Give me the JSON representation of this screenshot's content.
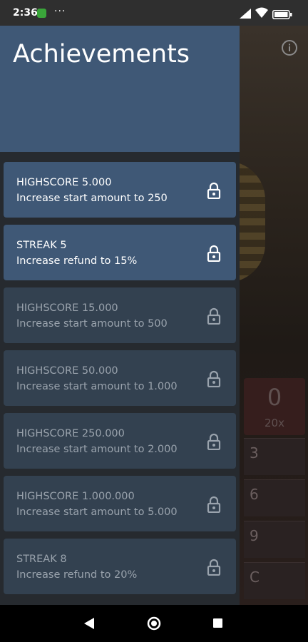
{
  "status_bar": {
    "time": "2:36",
    "more": "···"
  },
  "drawer": {
    "title": "Achievements"
  },
  "background": {
    "panel_big": "0",
    "panel_small": "20x",
    "keys": [
      "3",
      "6",
      "9",
      "C"
    ]
  },
  "achievements": [
    {
      "title": "HIGHSCORE 5.000",
      "description": "Increase start amount to 250",
      "state": "unlocked",
      "icon": "lock-icon"
    },
    {
      "title": "STREAK 5",
      "description": "Increase refund to 15%",
      "state": "unlocked",
      "icon": "lock-icon"
    },
    {
      "title": "HIGHSCORE 15.000",
      "description": "Increase start amount to 500",
      "state": "locked",
      "icon": "lock-icon"
    },
    {
      "title": "HIGHSCORE 50.000",
      "description": "Increase start amount to 1.000",
      "state": "locked",
      "icon": "lock-icon"
    },
    {
      "title": "HIGHSCORE 250.000",
      "description": "Increase start amount to 2.000",
      "state": "locked",
      "icon": "lock-icon"
    },
    {
      "title": "HIGHSCORE 1.000.000",
      "description": "Increase start amount to 5.000",
      "state": "locked",
      "icon": "lock-icon"
    },
    {
      "title": "STREAK 8",
      "description": "Increase refund to 20%",
      "state": "locked",
      "icon": "lock-icon"
    }
  ],
  "colors": {
    "header": "#3f5876",
    "card_unlocked": "#3f5876",
    "card_locked": "#334150",
    "drawer_bg": "#262a2f"
  }
}
